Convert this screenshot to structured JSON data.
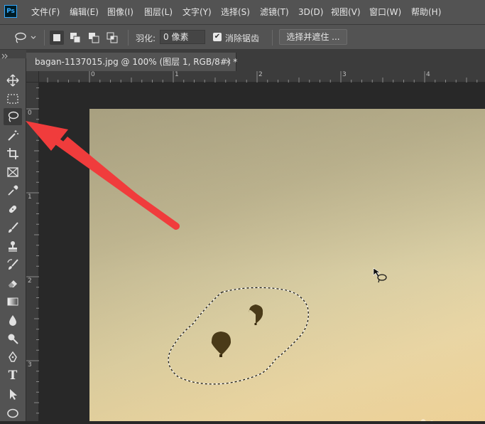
{
  "app": {
    "logo_text": "Ps"
  },
  "menu": [
    "文件(F)",
    "编辑(E)",
    "图像(I)",
    "图层(L)",
    "文字(Y)",
    "选择(S)",
    "滤镜(T)",
    "3D(D)",
    "视图(V)",
    "窗口(W)",
    "帮助(H)"
  ],
  "options": {
    "current_tool_icon": "lasso-icon",
    "feather_label": "羽化:",
    "feather_value": "0 像素",
    "antialias_label": "消除锯齿",
    "antialias_checked": true,
    "select_mask_label": "选择并遮住 ..."
  },
  "document": {
    "tab_title": "bagan-1137015.jpg @ 100% (图层 1, RGB/8#) *",
    "close_symbol": "×"
  },
  "rulers": {
    "horizontal": [
      "0",
      "1",
      "2",
      "3",
      "4"
    ],
    "vertical": [
      "0",
      "1",
      "2",
      "3"
    ]
  },
  "tools": [
    "move-icon",
    "marquee-icon",
    "lasso-icon",
    "magic-wand-icon",
    "crop-icon",
    "frame-icon",
    "eyedropper-icon",
    "healing-brush-icon",
    "brush-icon",
    "clone-stamp-icon",
    "history-brush-icon",
    "eraser-icon",
    "gradient-icon",
    "blur-icon",
    "dodge-icon",
    "pen-icon",
    "type-icon",
    "path-selection-icon",
    "ellipse-icon"
  ],
  "active_tool": "lasso-icon",
  "type_tool_glyph": "T",
  "colors": {
    "ui_panel": "#535353",
    "canvas_bg": "#282828",
    "annotation_arrow": "#f03c3c",
    "balloon": "#4a3a18"
  }
}
